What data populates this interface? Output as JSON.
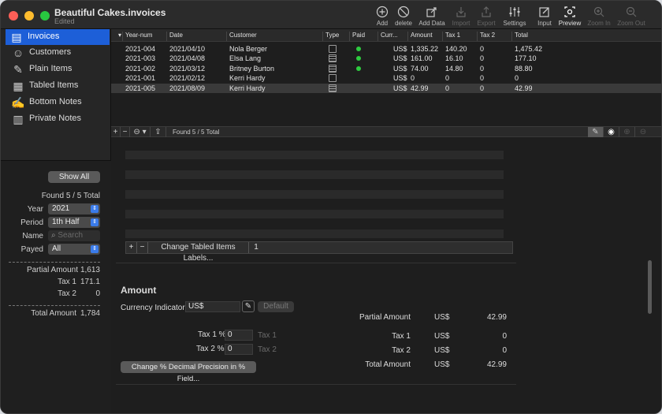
{
  "window": {
    "title": "Beautiful Cakes.invoices",
    "subtitle": "Edited"
  },
  "toolbar": [
    {
      "label": "Add",
      "icon": "add-icon",
      "dim": false
    },
    {
      "label": "delete",
      "icon": "delete-icon",
      "dim": false
    },
    {
      "label": "Add Data",
      "icon": "add-data-icon",
      "dim": false
    },
    {
      "label": "Import",
      "icon": "import-icon",
      "dim": true
    },
    {
      "label": "Export",
      "icon": "export-icon",
      "dim": true
    },
    {
      "label": "Settings",
      "icon": "settings-icon",
      "dim": false
    },
    {
      "label": "Input",
      "icon": "input-icon",
      "dim": false
    },
    {
      "label": "Preview",
      "icon": "preview-icon",
      "dim": false
    },
    {
      "label": "Zoom In",
      "icon": "zoom-in-icon",
      "dim": true
    },
    {
      "label": "Zoom Out",
      "icon": "zoom-out-icon",
      "dim": true
    }
  ],
  "sidebar": {
    "items": [
      {
        "label": "Invoices",
        "icon": "invoice-icon"
      },
      {
        "label": "Customers",
        "icon": "customers-icon"
      },
      {
        "label": "Plain Items",
        "icon": "plain-items-icon"
      },
      {
        "label": "Tabled Items",
        "icon": "tabled-items-icon"
      },
      {
        "label": "Bottom Notes",
        "icon": "bottom-notes-icon"
      },
      {
        "label": "Private Notes",
        "icon": "private-notes-icon"
      }
    ]
  },
  "filter": {
    "show_all": "Show All",
    "found": "Found 5 / 5 Total",
    "year_label": "Year",
    "year_value": "2021",
    "period_label": "Period",
    "period_value": "1th Half",
    "name_label": "Name",
    "name_placeholder": "Search",
    "payed_label": "Payed",
    "payed_value": "All",
    "partial_label": "Partial Amount",
    "partial_value": "1,613",
    "tax1_label": "Tax 1",
    "tax1_value": "171.1",
    "tax2_label": "Tax 2",
    "tax2_value": "0",
    "total_label": "Total Amount",
    "total_value": "1,784"
  },
  "table": {
    "columns": [
      "Year-num",
      "Date",
      "Customer",
      "Type",
      "Paid",
      "Curr...",
      "Amount",
      "Tax 1",
      "Tax 2",
      "Total"
    ],
    "rows": [
      {
        "yearnum": "2021-004",
        "date": "2021/04/10",
        "customer": "Nola Berger",
        "type": "plain",
        "paid": true,
        "curr": "US$",
        "amount": "1,335.22",
        "tax1": "140.20",
        "tax2": "0",
        "total": "1,475.42"
      },
      {
        "yearnum": "2021-003",
        "date": "2021/04/08",
        "customer": "Elsa Lang",
        "type": "tabled",
        "paid": true,
        "curr": "US$",
        "amount": "161.00",
        "tax1": "16.10",
        "tax2": "0",
        "total": "177.10"
      },
      {
        "yearnum": "2021-002",
        "date": "2021/03/12",
        "customer": "Britney Burton",
        "type": "tabled",
        "paid": true,
        "curr": "US$",
        "amount": "74.00",
        "tax1": "14.80",
        "tax2": "0",
        "total": "88.80"
      },
      {
        "yearnum": "2021-001",
        "date": "2021/02/12",
        "customer": "Kerri Hardy",
        "type": "plain",
        "paid": false,
        "curr": "US$",
        "amount": "0",
        "tax1": "0",
        "tax2": "0",
        "total": "0"
      },
      {
        "yearnum": "2021-005",
        "date": "2021/08/09",
        "customer": "Kerri Hardy",
        "type": "tabled",
        "paid": false,
        "curr": "US$",
        "amount": "42.99",
        "tax1": "0",
        "tax2": "0",
        "total": "42.99"
      }
    ],
    "footer_found": "Found 5 / 5 Total"
  },
  "tabled": {
    "change_labels": "Change Tabled Items Labels...",
    "count": "1"
  },
  "amount": {
    "heading": "Amount",
    "currency_label": "Currency Indicator",
    "currency_value": "US$",
    "default_button": "Default",
    "tax1_pct_label": "Tax 1 %",
    "tax1_pct_value": "0",
    "tax1_name": "Tax 1",
    "tax2_pct_label": "Tax 2 %",
    "tax2_pct_value": "0",
    "tax2_name": "Tax 2",
    "precision_button": "Change % Decimal Precision in % Field...",
    "summary": [
      {
        "label": "Partial Amount",
        "curr": "US$",
        "value": "42.99"
      },
      {
        "label": "Tax 1",
        "curr": "US$",
        "value": "0"
      },
      {
        "label": "Tax 2",
        "curr": "US$",
        "value": "0"
      },
      {
        "label": "Total Amount",
        "curr": "US$",
        "value": "42.99"
      }
    ]
  },
  "colors": {
    "accent": "#1d5fd8",
    "paid": "#2ecc40"
  }
}
